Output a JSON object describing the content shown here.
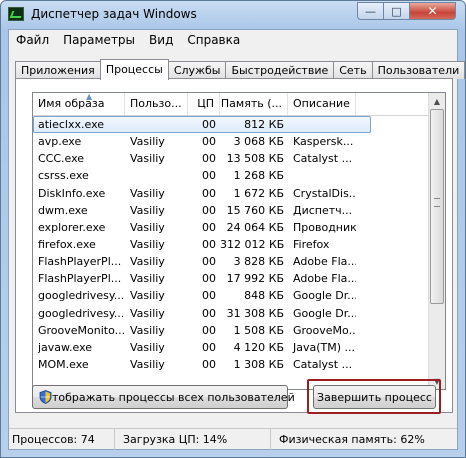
{
  "window": {
    "title": "Диспетчер задач Windows"
  },
  "menu": [
    "Файл",
    "Параметры",
    "Вид",
    "Справка"
  ],
  "tabs": [
    {
      "label": "Приложения",
      "active": false
    },
    {
      "label": "Процессы",
      "active": true
    },
    {
      "label": "Службы",
      "active": false
    },
    {
      "label": "Быстродействие",
      "active": false
    },
    {
      "label": "Сеть",
      "active": false
    },
    {
      "label": "Пользователи",
      "active": false
    }
  ],
  "table": {
    "columns": [
      "Имя образа",
      "Пользо...",
      "ЦП",
      "Память (...",
      "Описание"
    ],
    "sort_column": "Имя образа",
    "rows": [
      [
        "atieclxx.exe",
        "",
        "00",
        "812 КБ",
        ""
      ],
      [
        "avp.exe",
        "Vasiliy",
        "00",
        "3 068 КБ",
        "Kaspersk..."
      ],
      [
        "CCC.exe",
        "Vasiliy",
        "00",
        "13 508 КБ",
        "Catalyst ..."
      ],
      [
        "csrss.exe",
        "",
        "00",
        "1 268 КБ",
        ""
      ],
      [
        "DiskInfo.exe",
        "Vasiliy",
        "00",
        "1 672 КБ",
        "CrystalDis..."
      ],
      [
        "dwm.exe",
        "Vasiliy",
        "00",
        "15 760 КБ",
        "Диспетч..."
      ],
      [
        "explorer.exe",
        "Vasiliy",
        "00",
        "24 064 КБ",
        "Проводник"
      ],
      [
        "firefox.exe",
        "Vasiliy",
        "00",
        "312 012 КБ",
        "Firefox"
      ],
      [
        "FlashPlayerPl...",
        "Vasiliy",
        "00",
        "3 828 КБ",
        "Adobe Fla..."
      ],
      [
        "FlashPlayerPl...",
        "Vasiliy",
        "00",
        "17 992 КБ",
        "Adobe Fla..."
      ],
      [
        "googledrivesy...",
        "Vasiliy",
        "00",
        "848 КБ",
        "Google Dr..."
      ],
      [
        "googledrivesy...",
        "Vasiliy",
        "00",
        "31 308 КБ",
        "Google Dr..."
      ],
      [
        "GrooveMonito...",
        "Vasiliy",
        "00",
        "1 508 КБ",
        "GrooveMo..."
      ],
      [
        "javaw.exe",
        "Vasiliy",
        "00",
        "4 120 КБ",
        "Java(TM) ..."
      ],
      [
        "MOM.exe",
        "Vasiliy",
        "00",
        "1 308 КБ",
        "Catalyst ..."
      ]
    ],
    "selected_row": 0
  },
  "buttons": {
    "show_all": "Отображать процессы всех пользователей",
    "end_process": "Завершить процесс"
  },
  "status": {
    "processes": "Процессов: 74",
    "cpu": "Загрузка ЦП: 14%",
    "memory": "Физическая память: 62%"
  },
  "icons": {
    "app": "task-manager-icon",
    "shield": "uac-shield-icon",
    "minimize": "minimize-icon",
    "maximize": "maximize-icon",
    "close": "close-icon"
  }
}
